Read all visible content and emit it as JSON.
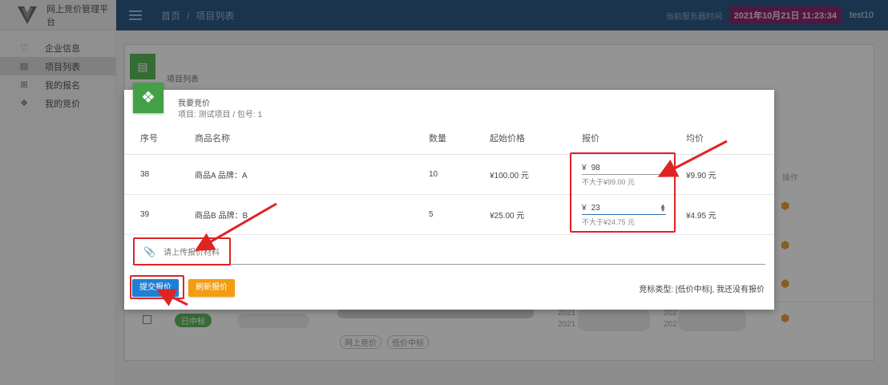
{
  "app": {
    "title": "网上竞价管理平台"
  },
  "sidebar": {
    "items": [
      {
        "label": "企业信息",
        "icon": "heart-outline-icon",
        "active": false
      },
      {
        "label": "项目列表",
        "icon": "list-icon",
        "active": true
      },
      {
        "label": "我的报名",
        "icon": "signup-icon",
        "active": false
      },
      {
        "label": "我的竞价",
        "icon": "diamond-icon",
        "active": false
      }
    ]
  },
  "header": {
    "breadcrumb": [
      "首页",
      "项目列表"
    ],
    "server_time_label": "当前服务器时间:",
    "server_time": "2021年10月21日 11:23:34",
    "username": "test10",
    "colors": {
      "bar": "#2e5b86",
      "time_badge": "#8a2a6e"
    }
  },
  "background": {
    "card_title": "项目列表",
    "status_badge": "已中标",
    "tags": [
      "网上竞价",
      "低价中标"
    ],
    "col_hint": "操作",
    "year_fragments": [
      "2021",
      "2021",
      "202",
      "202"
    ]
  },
  "modal": {
    "title": "我要竞价",
    "subtitle": "项目: 测试项目 / 包号: 1",
    "columns": [
      "序号",
      "商品名称",
      "数量",
      "起始价格",
      "报价",
      "均价"
    ],
    "rows": [
      {
        "no": "38",
        "name": "商品A 品牌：A",
        "qty": "10",
        "start_price": "¥100.00 元",
        "currency": "¥",
        "quote": "98",
        "hint": "不大于¥99.00 元",
        "avg": "¥9.90 元"
      },
      {
        "no": "39",
        "name": "商品B 品牌：B",
        "qty": "5",
        "start_price": "¥25.00 元",
        "currency": "¥",
        "quote": "23",
        "hint": "不大于¥24.75 元",
        "avg": "¥4.95 元"
      }
    ],
    "upload_placeholder": "请上传报价材料",
    "submit_label": "提交报价",
    "refresh_label": "刷新报价",
    "bid_type_text": "竞标类型: [低价中标], 我还没有报价",
    "colors": {
      "submit": "#1f7fd4",
      "refresh": "#f39c12",
      "icon": "#43a047",
      "annotation": "#e02424"
    }
  }
}
